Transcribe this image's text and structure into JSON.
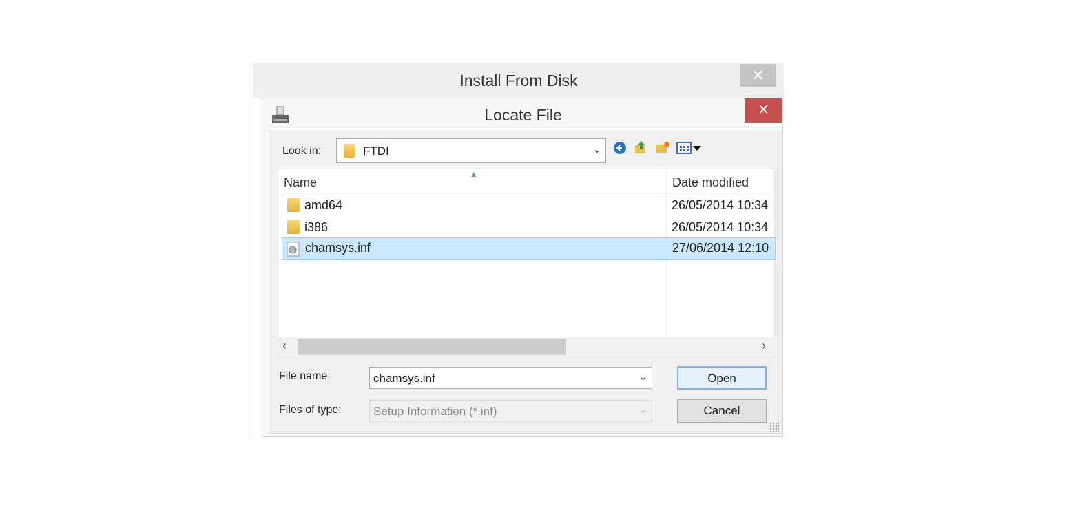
{
  "outer_dialog": {
    "title": "Install From Disk",
    "close": "✕"
  },
  "dialog": {
    "title": "Locate File",
    "close": "✕"
  },
  "look_in": {
    "label": "Look in:",
    "value": "FTDI"
  },
  "toolbar_icons": [
    "back-icon",
    "up-folder-icon",
    "new-folder-icon",
    "view-menu-icon"
  ],
  "list": {
    "columns": [
      "Name",
      "Date modified"
    ],
    "rows": [
      {
        "name": "amd64",
        "date": "26/05/2014 10:34",
        "type": "folder"
      },
      {
        "name": "i386",
        "date": "26/05/2014 10:34",
        "type": "folder"
      },
      {
        "name": "chamsys.inf",
        "date": "27/06/2014 12:10",
        "type": "file",
        "selected": true
      }
    ]
  },
  "file_name": {
    "label": "File name:",
    "value": "chamsys.inf"
  },
  "file_type": {
    "label": "Files of type:",
    "value": "Setup Information (*.inf)"
  },
  "buttons": {
    "open": "Open",
    "cancel": "Cancel"
  }
}
